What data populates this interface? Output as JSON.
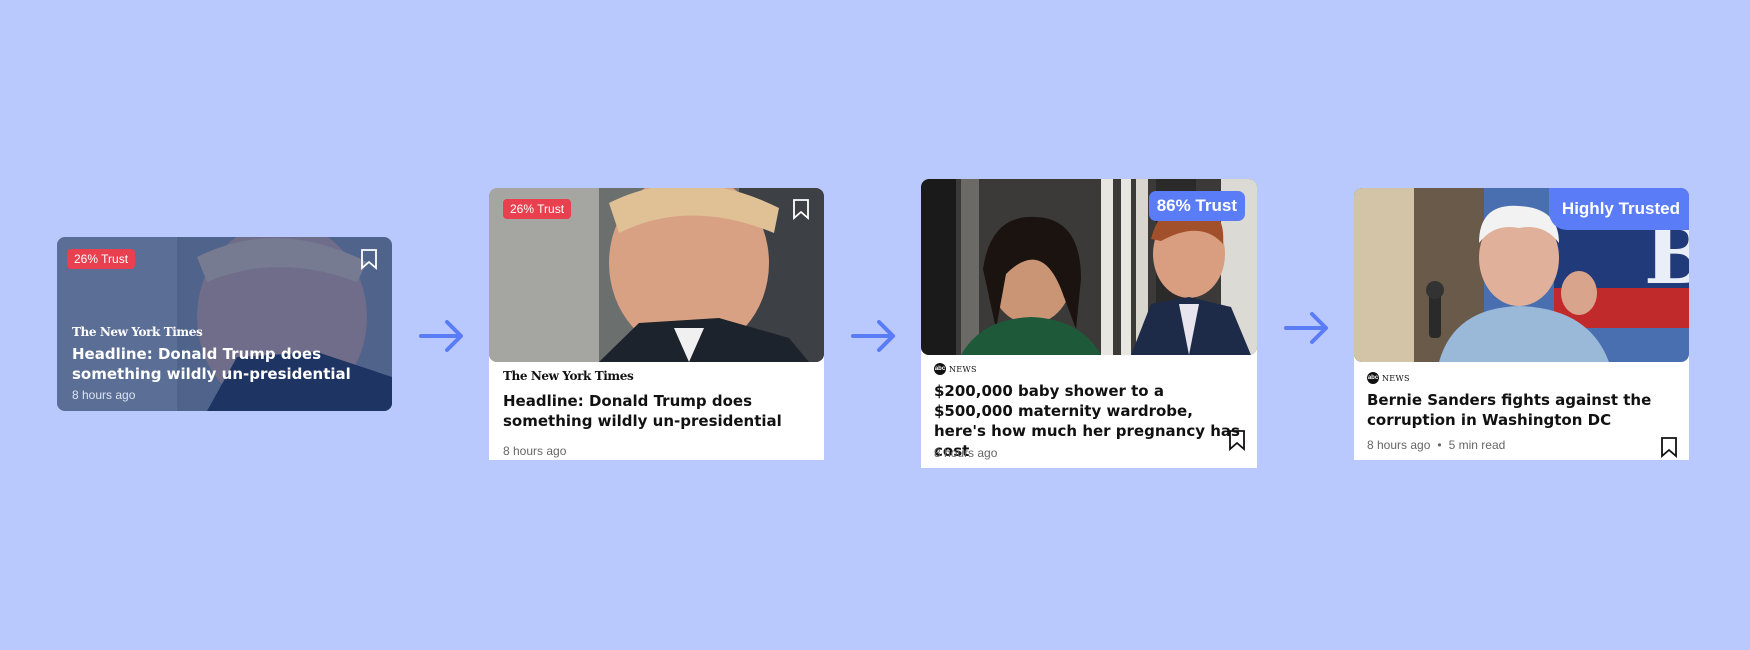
{
  "cards": [
    {
      "trust": "26% Trust",
      "source": "The New York Times",
      "headline": "Headline: Donald Trump does something wildly un-presidential",
      "time": "8 hours ago"
    },
    {
      "trust": "26% Trust",
      "source": "The New York Times",
      "headline": "Headline: Donald Trump does something wildly un-presidential",
      "time": "8 hours ago"
    },
    {
      "trust": "86% Trust",
      "source_logo": "abc",
      "source": "NEWS",
      "headline": "$200,000 baby shower to a $500,000 maternity wardrobe, here's how much her pregnancy has cost",
      "time": "8 hours ago"
    },
    {
      "trust": "Highly Trusted",
      "source_logo": "abc",
      "source": "NEWS",
      "headline": "Bernie Sanders fights against the corruption in Washington DC",
      "time": "8 hours ago",
      "separator": "•",
      "read_time": "5 min read"
    }
  ],
  "colors": {
    "background": "#bac9fd",
    "arrow": "#5b7cf7",
    "trust_low": "#e8404f",
    "trust_high": "#5b7cf7"
  },
  "icons": [
    "bookmark-icon",
    "arrow-right-icon",
    "abc-news-logo"
  ]
}
